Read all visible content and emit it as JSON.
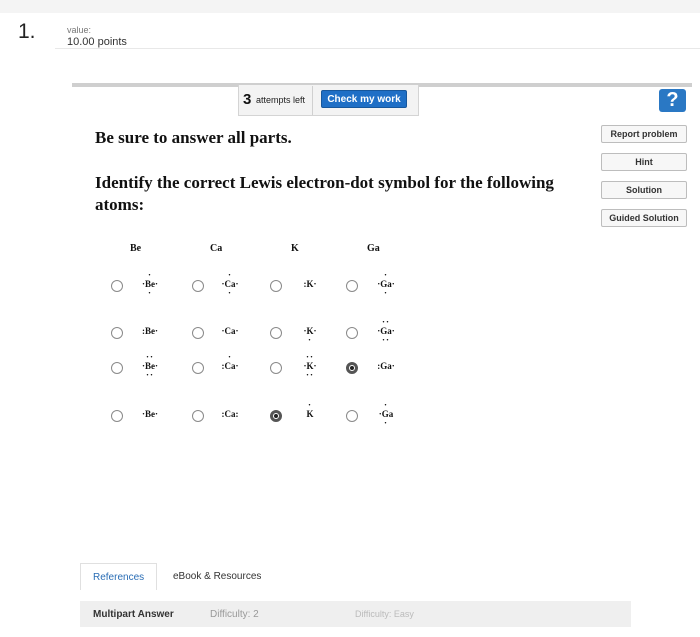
{
  "question": {
    "number": "1.",
    "value_label": "value:",
    "points": "10.00 points"
  },
  "toolbar": {
    "attempts_count": "3",
    "attempts_text": "attempts left",
    "check_label": "Check my work",
    "help_glyph": "?"
  },
  "side_buttons": [
    "Report problem",
    "Hint",
    "Solution",
    "Guided Solution"
  ],
  "instruction": "Be sure to answer all parts.",
  "prompt": "Identify the correct Lewis electron-dot symbol for the following atoms:",
  "columns": [
    {
      "header": "Be",
      "options": [
        {
          "top": "·",
          "left": "·",
          "symbol": "Be",
          "right": "·",
          "bottom": "·",
          "selected": false
        },
        {
          "top": "",
          "left": ":",
          "symbol": "Be",
          "right": "·",
          "bottom": "",
          "selected": false
        },
        {
          "top": "··",
          "left": "·",
          "symbol": "Be",
          "right": "·",
          "bottom": "··",
          "selected": false
        },
        {
          "top": "",
          "left": "·",
          "symbol": "Be",
          "right": "·",
          "bottom": "",
          "selected": false
        }
      ]
    },
    {
      "header": "Ca",
      "options": [
        {
          "top": "·",
          "left": "·",
          "symbol": "Ca",
          "right": "·",
          "bottom": "·",
          "selected": false
        },
        {
          "top": "",
          "left": "·",
          "symbol": "Ca",
          "right": "·",
          "bottom": "",
          "selected": false
        },
        {
          "top": "·",
          "left": ":",
          "symbol": "Ca",
          "right": "·",
          "bottom": "",
          "selected": false
        },
        {
          "top": "",
          "left": ":",
          "symbol": "Ca",
          "right": ":",
          "bottom": "",
          "selected": false
        }
      ]
    },
    {
      "header": "K",
      "options": [
        {
          "top": "",
          "left": ":",
          "symbol": "K",
          "right": "·",
          "bottom": "",
          "selected": false
        },
        {
          "top": "",
          "left": "·",
          "symbol": "K",
          "right": "·",
          "bottom": "·",
          "selected": false
        },
        {
          "top": "··",
          "left": "·",
          "symbol": "K",
          "right": "·",
          "bottom": "··",
          "selected": false
        },
        {
          "top": "·",
          "left": "",
          "symbol": "K",
          "right": "",
          "bottom": "",
          "selected": true
        }
      ]
    },
    {
      "header": "Ga",
      "options": [
        {
          "top": "·",
          "left": "·",
          "symbol": "Ga",
          "right": "·",
          "bottom": "·",
          "selected": false
        },
        {
          "top": "··",
          "left": "·",
          "symbol": "Ga",
          "right": "·",
          "bottom": "··",
          "selected": false
        },
        {
          "top": "",
          "left": ":",
          "symbol": "Ga",
          "right": "·",
          "bottom": "",
          "selected": true
        },
        {
          "top": "·",
          "left": "·",
          "symbol": "Ga",
          "right": "",
          "bottom": "·",
          "selected": false
        }
      ]
    }
  ],
  "tabs": [
    "References",
    "eBook & Resources"
  ],
  "footer": {
    "label": "Multipart Answer",
    "difficulty": "Difficulty: 2",
    "difficulty_word": "Difficulty: Easy"
  },
  "colors": {
    "accent": "#1f6fc6",
    "link": "#2a6db5"
  }
}
